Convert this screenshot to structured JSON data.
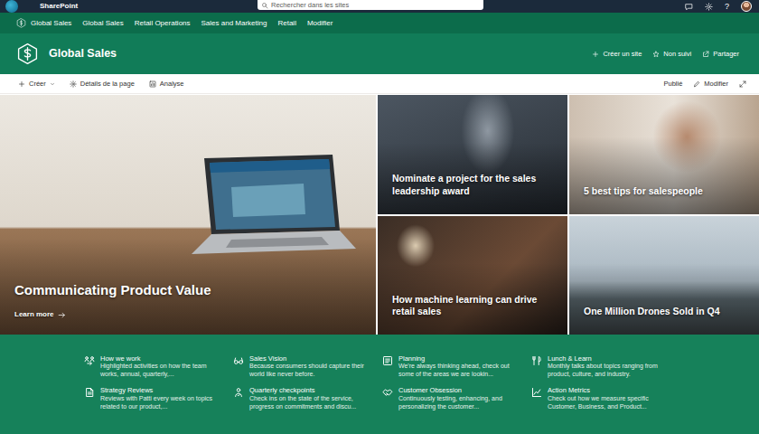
{
  "suite_bar": {
    "app_name": "SharePoint",
    "search": {
      "placeholder": "Rechercher dans les sites"
    },
    "help": "?"
  },
  "hub_nav": {
    "home": "Global Sales",
    "items": [
      {
        "label": "Global Sales"
      },
      {
        "label": "Retail Operations"
      },
      {
        "label": "Sales and Marketing"
      },
      {
        "label": "Retail"
      },
      {
        "label": "Modifier"
      }
    ]
  },
  "site_header": {
    "title": "Global Sales",
    "actions": [
      {
        "label": "Créer un site"
      },
      {
        "label": "Non suivi"
      },
      {
        "label": "Partager"
      }
    ]
  },
  "command_bar": {
    "left": [
      {
        "label": "Créer"
      },
      {
        "label": "Détails de la page"
      },
      {
        "label": "Analyse"
      }
    ],
    "status": "Publié",
    "edit": "Modifier"
  },
  "hero": {
    "main": {
      "title": "Communicating Product Value",
      "link": "Learn more"
    },
    "tiles": [
      {
        "title": "Nominate a project for the sales leadership award"
      },
      {
        "title": "5 best tips for salespeople"
      },
      {
        "title": "How machine learning can drive retail sales"
      },
      {
        "title": "One Million Drones Sold in Q4"
      }
    ]
  },
  "quick_links": [
    {
      "title": "How we work",
      "description": "Highlighted activities on how the team works, annual, quarterly,..."
    },
    {
      "title": "Sales Vision",
      "description": "Because consumers should capture their world like never before."
    },
    {
      "title": "Planning",
      "description": "We're always thinking ahead, check out some of the areas we are lookin..."
    },
    {
      "title": "Lunch & Learn",
      "description": "Monthly talks about topics ranging from product, culture, and industry."
    },
    {
      "title": "Strategy Reviews",
      "description": "Reviews with Patti every week on topics related to our product,..."
    },
    {
      "title": "Quarterly checkpoints",
      "description": "Check ins on the state of the service, progress on commitments and discu..."
    },
    {
      "title": "Customer Obsession",
      "description": "Continuously testing, enhancing, and personalizing the customer..."
    },
    {
      "title": "Action Metrics",
      "description": "Check out how we measure specific Customer, Business, and Product..."
    }
  ]
}
